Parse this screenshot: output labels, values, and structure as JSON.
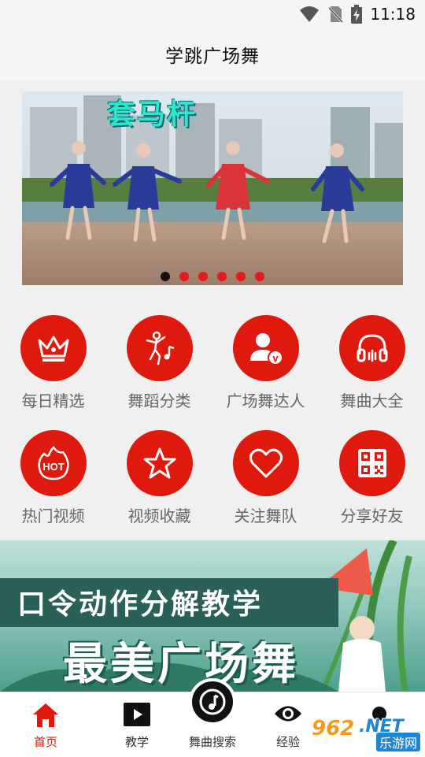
{
  "status_bar": {
    "time": "11:18"
  },
  "header": {
    "title": "学跳广场舞"
  },
  "banner": {
    "caption": "套马杆",
    "dots": 6,
    "active_dot": 0
  },
  "grid": {
    "items": [
      {
        "label": "每日精选",
        "icon": "crown-icon"
      },
      {
        "label": "舞蹈分类",
        "icon": "dancer-music-icon"
      },
      {
        "label": "广场舞达人",
        "icon": "vip-user-icon"
      },
      {
        "label": "舞曲大全",
        "icon": "headphones-icon"
      },
      {
        "label": "热门视频",
        "icon": "hot-flame-icon"
      },
      {
        "label": "视频收藏",
        "icon": "star-icon"
      },
      {
        "label": "关注舞队",
        "icon": "heart-icon"
      },
      {
        "label": "分享好友",
        "icon": "qr-code-icon"
      }
    ]
  },
  "promo": {
    "line1": "口令动作分解教学",
    "line2": "最美广场舞"
  },
  "tabbar": {
    "tabs": [
      {
        "label": "首页",
        "icon": "home-icon",
        "active": true
      },
      {
        "label": "教学",
        "icon": "play-icon",
        "active": false
      },
      {
        "label": "舞曲搜索",
        "icon": "music-search-icon",
        "active": false
      },
      {
        "label": "经验",
        "icon": "eye-icon",
        "active": false
      },
      {
        "label": "",
        "icon": "profile-icon",
        "active": false
      }
    ]
  },
  "watermark": {
    "number": "962",
    "net": ".NET",
    "text": "乐游网"
  },
  "colors": {
    "accent": "#e0190e",
    "dot_active": "#111111",
    "dot": "#e31b1b"
  }
}
